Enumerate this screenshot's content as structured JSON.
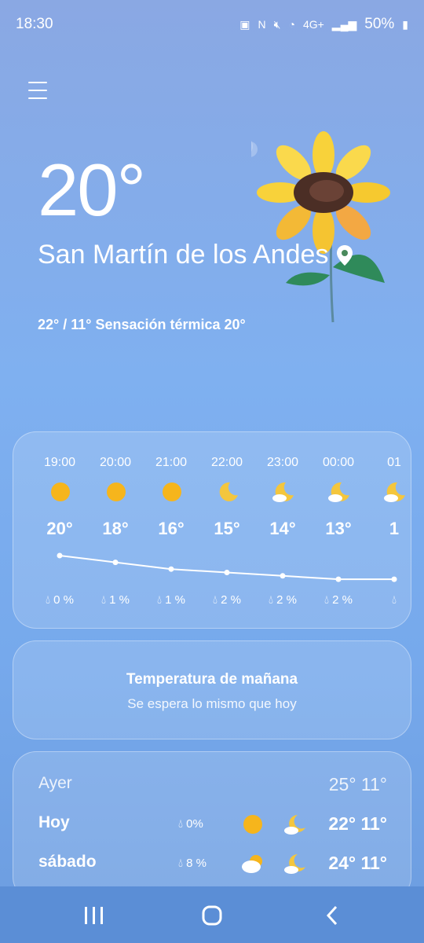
{
  "status": {
    "time": "18:30",
    "network": "4G+",
    "battery": "50%"
  },
  "weather": {
    "current_temp": "20°",
    "city": "San Martín de los Andes",
    "range": "22° / 11° Sensación térmica 20°"
  },
  "hourly": [
    {
      "time": "19:00",
      "temp": "20°",
      "precip": "0 %",
      "icon": "sun-icon"
    },
    {
      "time": "20:00",
      "temp": "18°",
      "precip": "1 %",
      "icon": "sun-icon"
    },
    {
      "time": "21:00",
      "temp": "16°",
      "precip": "1 %",
      "icon": "sun-icon"
    },
    {
      "time": "22:00",
      "temp": "15°",
      "precip": "2 %",
      "icon": "moon-icon"
    },
    {
      "time": "23:00",
      "temp": "14°",
      "precip": "2 %",
      "icon": "moon-cloud-icon"
    },
    {
      "time": "00:00",
      "temp": "13°",
      "precip": "2 %",
      "icon": "moon-cloud-icon"
    },
    {
      "time": "01",
      "temp": "1",
      "precip": "",
      "icon": "moon-cloud-icon"
    }
  ],
  "tomorrow": {
    "title": "Temperatura de mañana",
    "subtitle": "Se espera lo mismo que hoy"
  },
  "daily": [
    {
      "day": "Ayer",
      "precip": "",
      "temps": "25° 11°"
    },
    {
      "day": "Hoy",
      "precip": "0%",
      "temps": "22° 11°"
    },
    {
      "day": "sábado",
      "precip": "8 %",
      "temps": "24° 11°"
    }
  ],
  "colors": {
    "sun": "#f6b51c",
    "moon": "#f4c63d",
    "bg_top": "#8aa8e3",
    "bg_bottom": "#6c9cdf"
  }
}
